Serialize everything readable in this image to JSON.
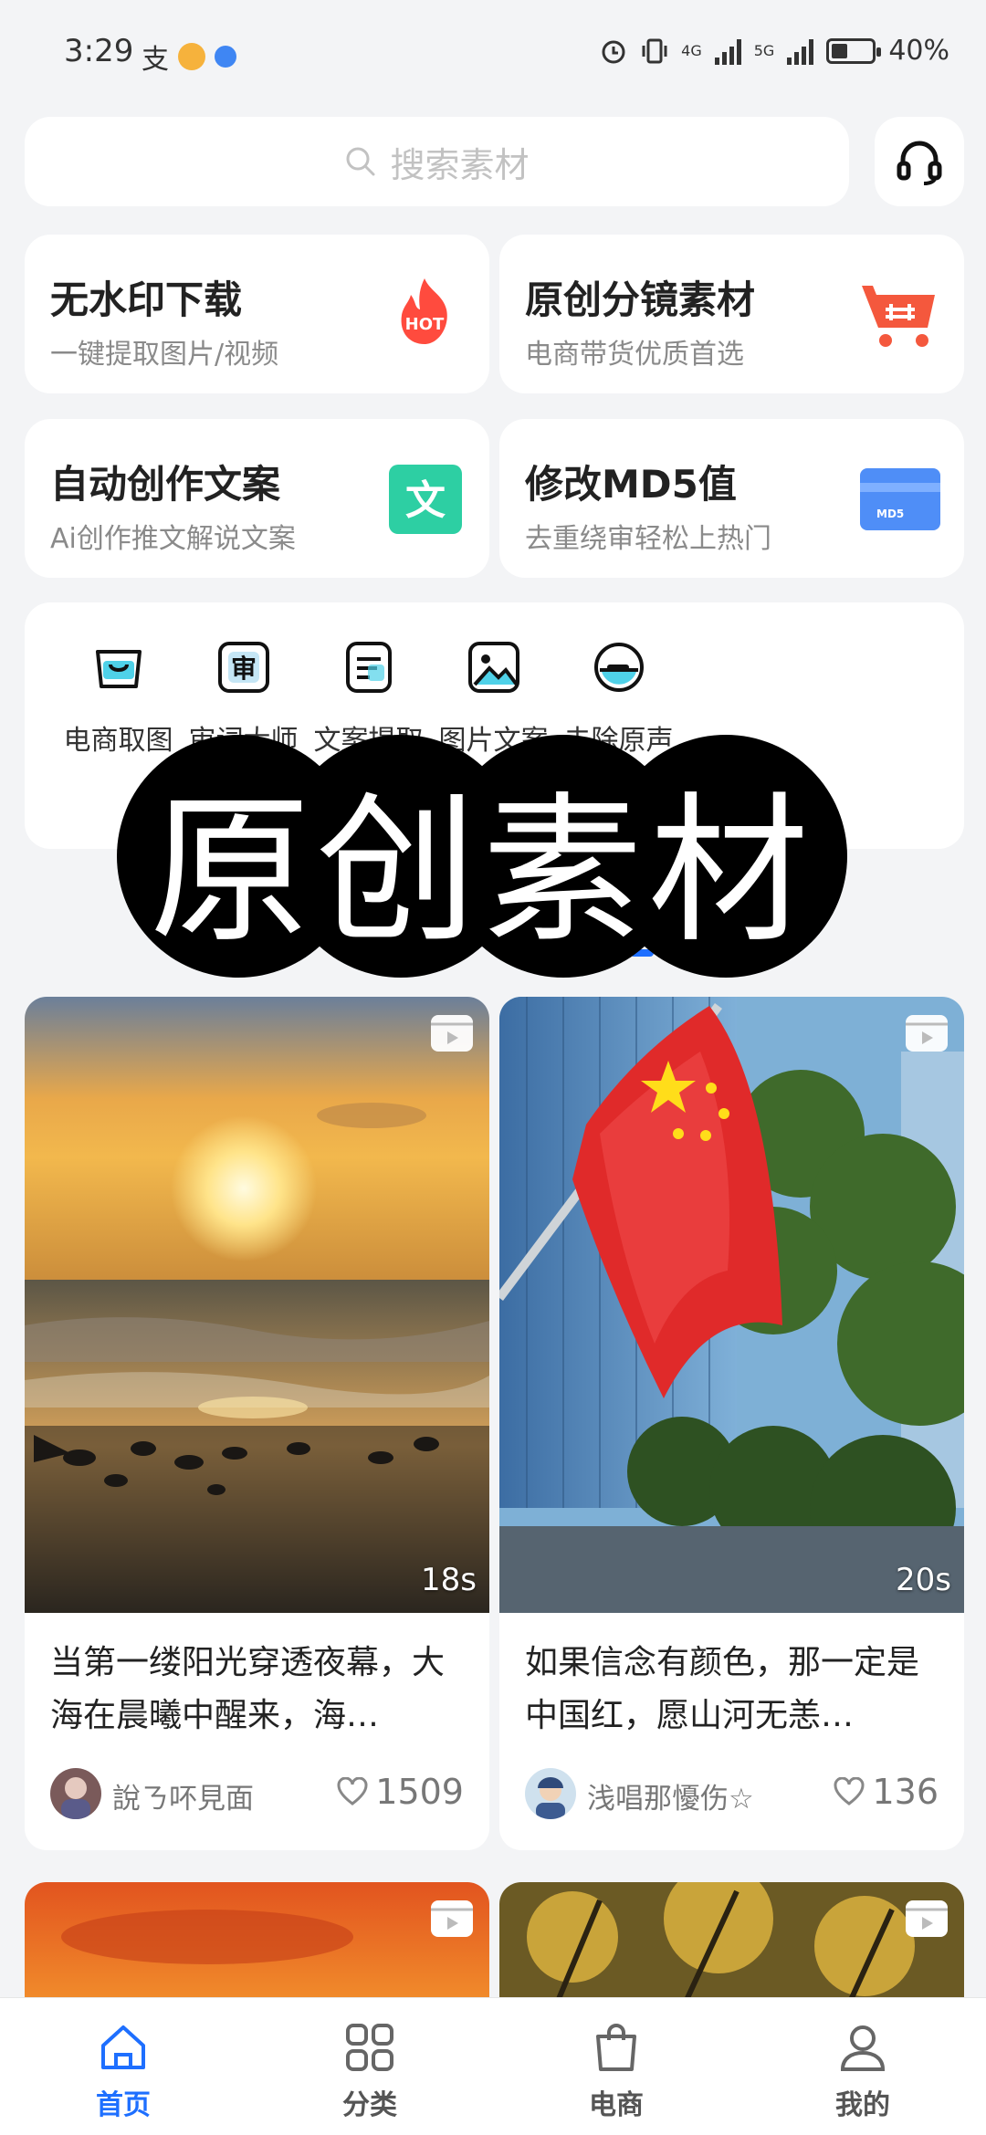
{
  "status_bar": {
    "time": "3:29",
    "network_1": "4G",
    "network_2": "5G",
    "battery": "40%",
    "battery_level": 0.4
  },
  "search": {
    "placeholder": "搜索素材"
  },
  "feature_cards": [
    {
      "title": "无水印下载",
      "subtitle": "一键提取图片/视频",
      "icon": "hot-icon",
      "badge": "HOT"
    },
    {
      "title": "原创分镜素材",
      "subtitle": "电商带货优质首选",
      "icon": "cart-icon"
    },
    {
      "title": "自动创作文案",
      "subtitle": "Ai创作推文解说文案",
      "icon": "text-icon",
      "badge": "文"
    },
    {
      "title": "修改MD5值",
      "subtitle": "去重绕审轻松上热门",
      "icon": "card-icon",
      "badge": "MD5"
    }
  ],
  "tools": [
    {
      "label": "电商取图",
      "icon": "bag-icon"
    },
    {
      "label": "审词大师",
      "icon": "review-icon",
      "glyph": "审"
    },
    {
      "label": "文案提取",
      "icon": "document-icon"
    },
    {
      "label": "图片文案",
      "icon": "image-icon"
    },
    {
      "label": "去除原声",
      "icon": "mute-icon"
    }
  ],
  "overlay": {
    "text": "原创素材"
  },
  "feed": [
    {
      "title": "当第一缕阳光穿透夜幕，大海在晨曦中醒来，海…",
      "duration": "18s",
      "author": "說ㄋ吥見面",
      "likes": "1509"
    },
    {
      "title": "如果信念有颜色，那一定是中国红，愿山河无恙…",
      "duration": "20s",
      "author": "浅唱那懮伤☆",
      "likes": "136"
    }
  ],
  "bottom_nav": [
    {
      "label": "首页",
      "icon": "home-icon",
      "active": true
    },
    {
      "label": "分类",
      "icon": "grid-icon",
      "active": false
    },
    {
      "label": "电商",
      "icon": "shopping-bag-icon",
      "active": false
    },
    {
      "label": "我的",
      "icon": "profile-icon",
      "active": false
    }
  ],
  "colors": {
    "accent": "#1e6fff",
    "hot": "#ff4b3e",
    "cart": "#f4583d",
    "text_icon": "#2dcfa3",
    "card_icon": "#4f8ef7"
  }
}
